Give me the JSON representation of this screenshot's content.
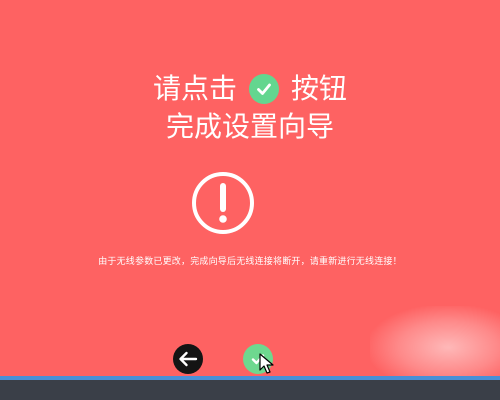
{
  "instruction": {
    "line1_before": "请点击",
    "line1_after": "按钮",
    "line2": "完成设置向导"
  },
  "notice": {
    "text": "由于无线参数已更改，完成向导后无线连接将断开，请重新进行无线连接！"
  },
  "icons": {
    "inline": "check-circle-icon",
    "warning": "exclamation-circle-icon",
    "back": "arrow-left-icon",
    "confirm": "check-icon"
  },
  "colors": {
    "background": "#fe6262",
    "confirm": "#6ed88f",
    "back": "#141414",
    "text": "#ffffff",
    "taskbar": "#3a3f48",
    "taskbar_accent": "#4a8fd6"
  }
}
